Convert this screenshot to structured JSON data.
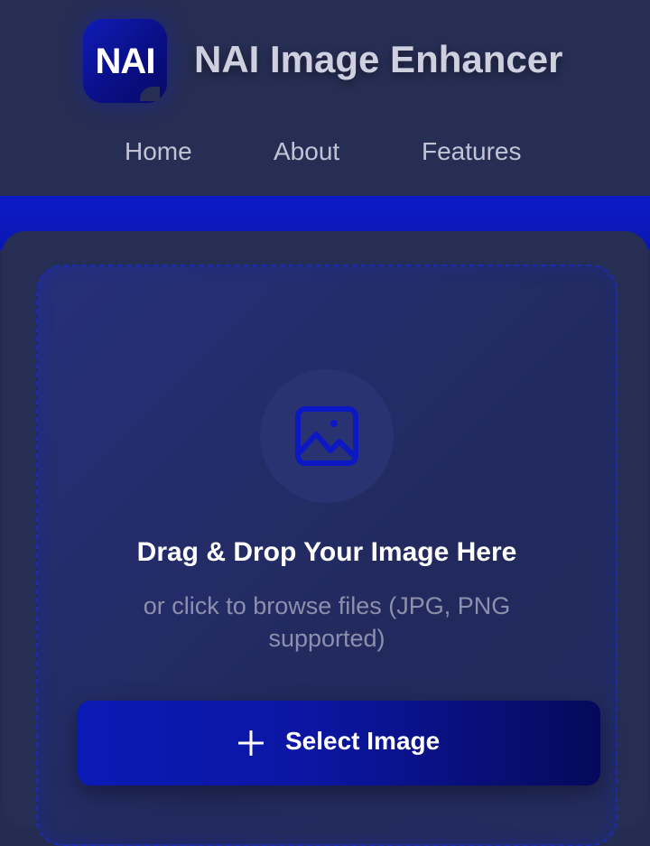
{
  "header": {
    "logo_text": "NAI",
    "app_title": "NAI Image Enhancer"
  },
  "nav": {
    "items": [
      {
        "label": "Home"
      },
      {
        "label": "About"
      },
      {
        "label": "Features"
      }
    ]
  },
  "upload": {
    "icon": "image-icon",
    "heading": "Drag & Drop Your Image Here",
    "subtext": "or click to browse files (JPG, PNG supported)",
    "button_icon": "plus-icon",
    "button_label": "Select Image"
  },
  "colors": {
    "background": "#252c52",
    "accent": "#0d1bc8",
    "button_gradient_end": "#06095a"
  }
}
